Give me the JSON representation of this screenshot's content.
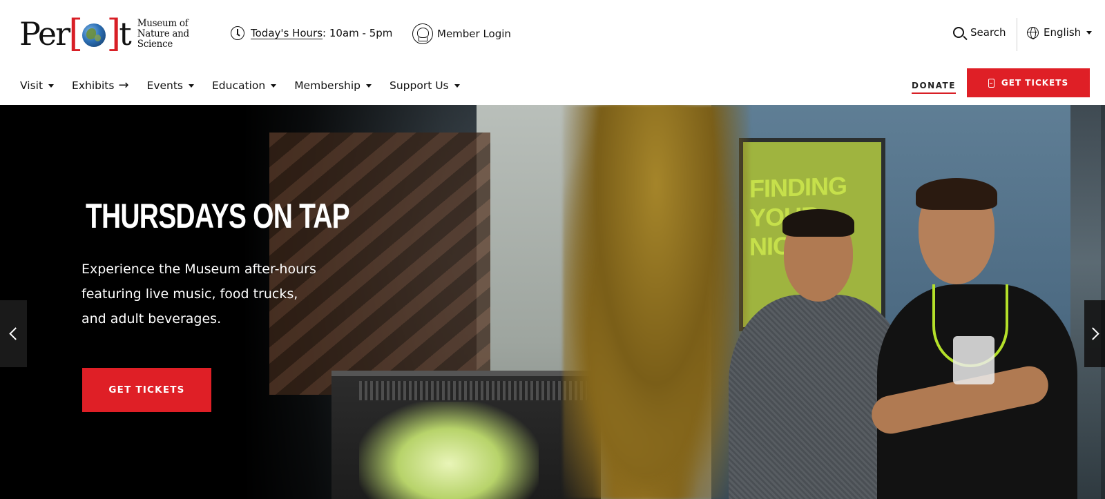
{
  "header": {
    "logo": {
      "word_left": "Per",
      "word_right": "t",
      "subtitle_line1": "Museum of",
      "subtitle_line2": "Nature and Science"
    },
    "hours": {
      "link_label": "Today's Hours",
      "value": ": 10am - 5pm",
      "icon": "clock-icon"
    },
    "member_login": {
      "label": "Member Login",
      "icon": "astronaut-icon"
    },
    "search": {
      "label": "Search",
      "icon": "search-icon"
    },
    "language": {
      "label": "English",
      "icon": "globe-icon"
    }
  },
  "nav": {
    "items": [
      {
        "label": "Visit",
        "indicator": "caret"
      },
      {
        "label": "Exhibits",
        "indicator": "arrow"
      },
      {
        "label": "Events",
        "indicator": "caret"
      },
      {
        "label": "Education",
        "indicator": "caret"
      },
      {
        "label": "Membership",
        "indicator": "caret"
      },
      {
        "label": "Support Us",
        "indicator": "caret"
      }
    ],
    "donate_label": "DONATE",
    "tickets_label": "GET TICKETS"
  },
  "hero": {
    "title": "THURSDAYS ON TAP",
    "description_lines": [
      "Experience the Museum after-hours",
      "featuring live music, food trucks,",
      "and adult beverages."
    ],
    "button_label": "GET TICKETS",
    "photo_sign_text": "FINDING YOUR NICHE"
  },
  "colors": {
    "brand_red": "#df1f26",
    "text_dark": "#111111",
    "hero_bg": "#000000"
  }
}
